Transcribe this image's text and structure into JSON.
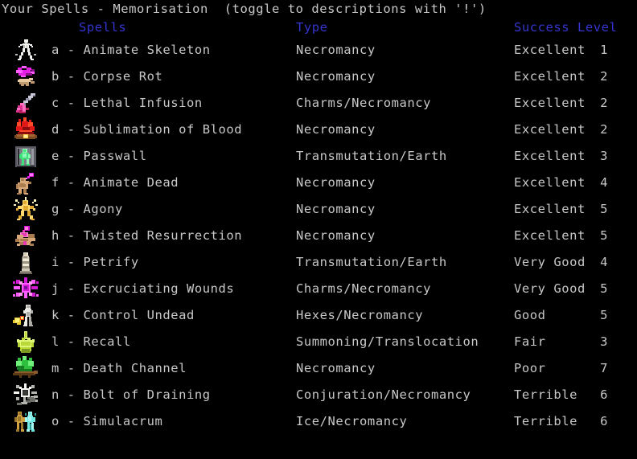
{
  "title": "Your Spells - Memorisation  (toggle to descriptions with '!')",
  "colors": {
    "background": "#000000",
    "header_blue": "#3535cf",
    "text_gray": "#c8c8c8"
  },
  "columns": {
    "spells": "Spells",
    "type": "Type",
    "success": "Success",
    "level": "Level"
  },
  "spells": [
    {
      "letter": "a",
      "name": "a - Animate Skeleton",
      "type": "Necromancy",
      "success": "Excellent",
      "level": "1",
      "icon": "animate-skeleton-icon"
    },
    {
      "letter": "b",
      "name": "b - Corpse Rot",
      "type": "Necromancy",
      "success": "Excellent",
      "level": "2",
      "icon": "corpse-rot-icon"
    },
    {
      "letter": "c",
      "name": "c - Lethal Infusion",
      "type": "Charms/Necromancy",
      "success": "Excellent",
      "level": "2",
      "icon": "lethal-infusion-icon"
    },
    {
      "letter": "d",
      "name": "d - Sublimation of Blood",
      "type": "Necromancy",
      "success": "Excellent",
      "level": "2",
      "icon": "sublimation-of-blood-icon"
    },
    {
      "letter": "e",
      "name": "e - Passwall",
      "type": "Transmutation/Earth",
      "success": "Excellent",
      "level": "3",
      "icon": "passwall-icon"
    },
    {
      "letter": "f",
      "name": "f - Animate Dead",
      "type": "Necromancy",
      "success": "Excellent",
      "level": "4",
      "icon": "animate-dead-icon"
    },
    {
      "letter": "g",
      "name": "g - Agony",
      "type": "Necromancy",
      "success": "Excellent",
      "level": "5",
      "icon": "agony-icon"
    },
    {
      "letter": "h",
      "name": "h - Twisted Resurrection",
      "type": "Necromancy",
      "success": "Excellent",
      "level": "5",
      "icon": "twisted-resurrection-icon"
    },
    {
      "letter": "i",
      "name": "i - Petrify",
      "type": "Transmutation/Earth",
      "success": "Very Good",
      "level": "4",
      "icon": "petrify-icon"
    },
    {
      "letter": "j",
      "name": "j - Excruciating Wounds",
      "type": "Charms/Necromancy",
      "success": "Very Good",
      "level": "5",
      "icon": "excruciating-wounds-icon"
    },
    {
      "letter": "k",
      "name": "k - Control Undead",
      "type": "Hexes/Necromancy",
      "success": "Good",
      "level": "5",
      "icon": "control-undead-icon"
    },
    {
      "letter": "l",
      "name": "l - Recall",
      "type": "Summoning/Translocation",
      "success": "Fair",
      "level": "3",
      "icon": "recall-icon"
    },
    {
      "letter": "m",
      "name": "m - Death Channel",
      "type": "Necromancy",
      "success": "Poor",
      "level": "7",
      "icon": "death-channel-icon"
    },
    {
      "letter": "n",
      "name": "n - Bolt of Draining",
      "type": "Conjuration/Necromancy",
      "success": "Terrible",
      "level": "6",
      "icon": "bolt-of-draining-icon"
    },
    {
      "letter": "o",
      "name": "o - Simulacrum",
      "type": "Ice/Necromancy",
      "success": "Terrible",
      "level": "6",
      "icon": "simulacrum-icon"
    }
  ]
}
